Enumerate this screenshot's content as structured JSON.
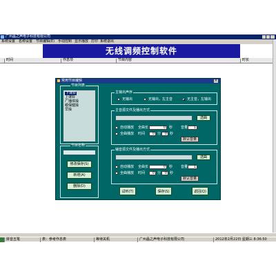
{
  "app": {
    "title": "广州晶之声电子科技有限公司",
    "menu": [
      "系统设置",
      "名称设置",
      "节目编辑(E)",
      "手动控制",
      "显示播放",
      "打印",
      "系统退出"
    ],
    "banner_title": "无线调频控制软件",
    "grid_headers": [
      "时间",
      "作息项",
      "节目内容",
      "时长"
    ]
  },
  "dialog": {
    "title": "常用节目编辑",
    "close_label": "×",
    "program_list": {
      "group_title": "节目列表",
      "items": [
        "下课铃",
        "上课铃",
        "广播体操",
        "眼保健操",
        "早操"
      ]
    },
    "program_name": {
      "group_title": "节目名称",
      "save_label": "修改保存(S)",
      "add_label": "新增(A)",
      "delete_label": "删除(D)"
    },
    "output": {
      "group_title": "主输出声序",
      "options": [
        "无输出",
        "无输出，左主音",
        "无主音，左输出"
      ],
      "selected_index": 2
    },
    "main_file": {
      "group_title": "主音源文件及播出方式",
      "select_label": "选曲",
      "auto_play": "自动播放",
      "full_length": "全曲长",
      "volume": "音量",
      "length_value": "0",
      "sec_unit": "秒",
      "volume_value": "1",
      "range_play": "全曲播放",
      "time_label": "时间",
      "from_value": "0",
      "from_unit": "分",
      "to_value": "0",
      "to_unit": "秒",
      "default_volume": "默认音量"
    },
    "aux_file": {
      "group_title": "辅音源文件及播出方式",
      "select_label": "选曲",
      "auto_play": "自动播放",
      "full_length": "全曲长",
      "volume": "音量",
      "length_value": "0",
      "sec_unit": "秒",
      "volume_value": "1",
      "range_play": "全曲播放",
      "time_label": "时间",
      "from_value": "0",
      "from_unit": "分",
      "to_value": "0",
      "to_unit": "秒",
      "default_volume": "默认音量"
    },
    "bottom_buttons": {
      "test": "试听(T)",
      "save": "保存(S)",
      "back": "返回(Q)"
    }
  },
  "status": {
    "cells": [
      "表：参考作息表",
      "等待关机",
      "广州晶之声电子科技有限公司",
      "2012年2月22日 星期三 8:36:50"
    ],
    "ime": "拼音五笔"
  },
  "colors": {
    "dialog_bg": "#006666",
    "banner_bg": "#1a1aa0",
    "titlebar_bg": "#0a246a"
  }
}
